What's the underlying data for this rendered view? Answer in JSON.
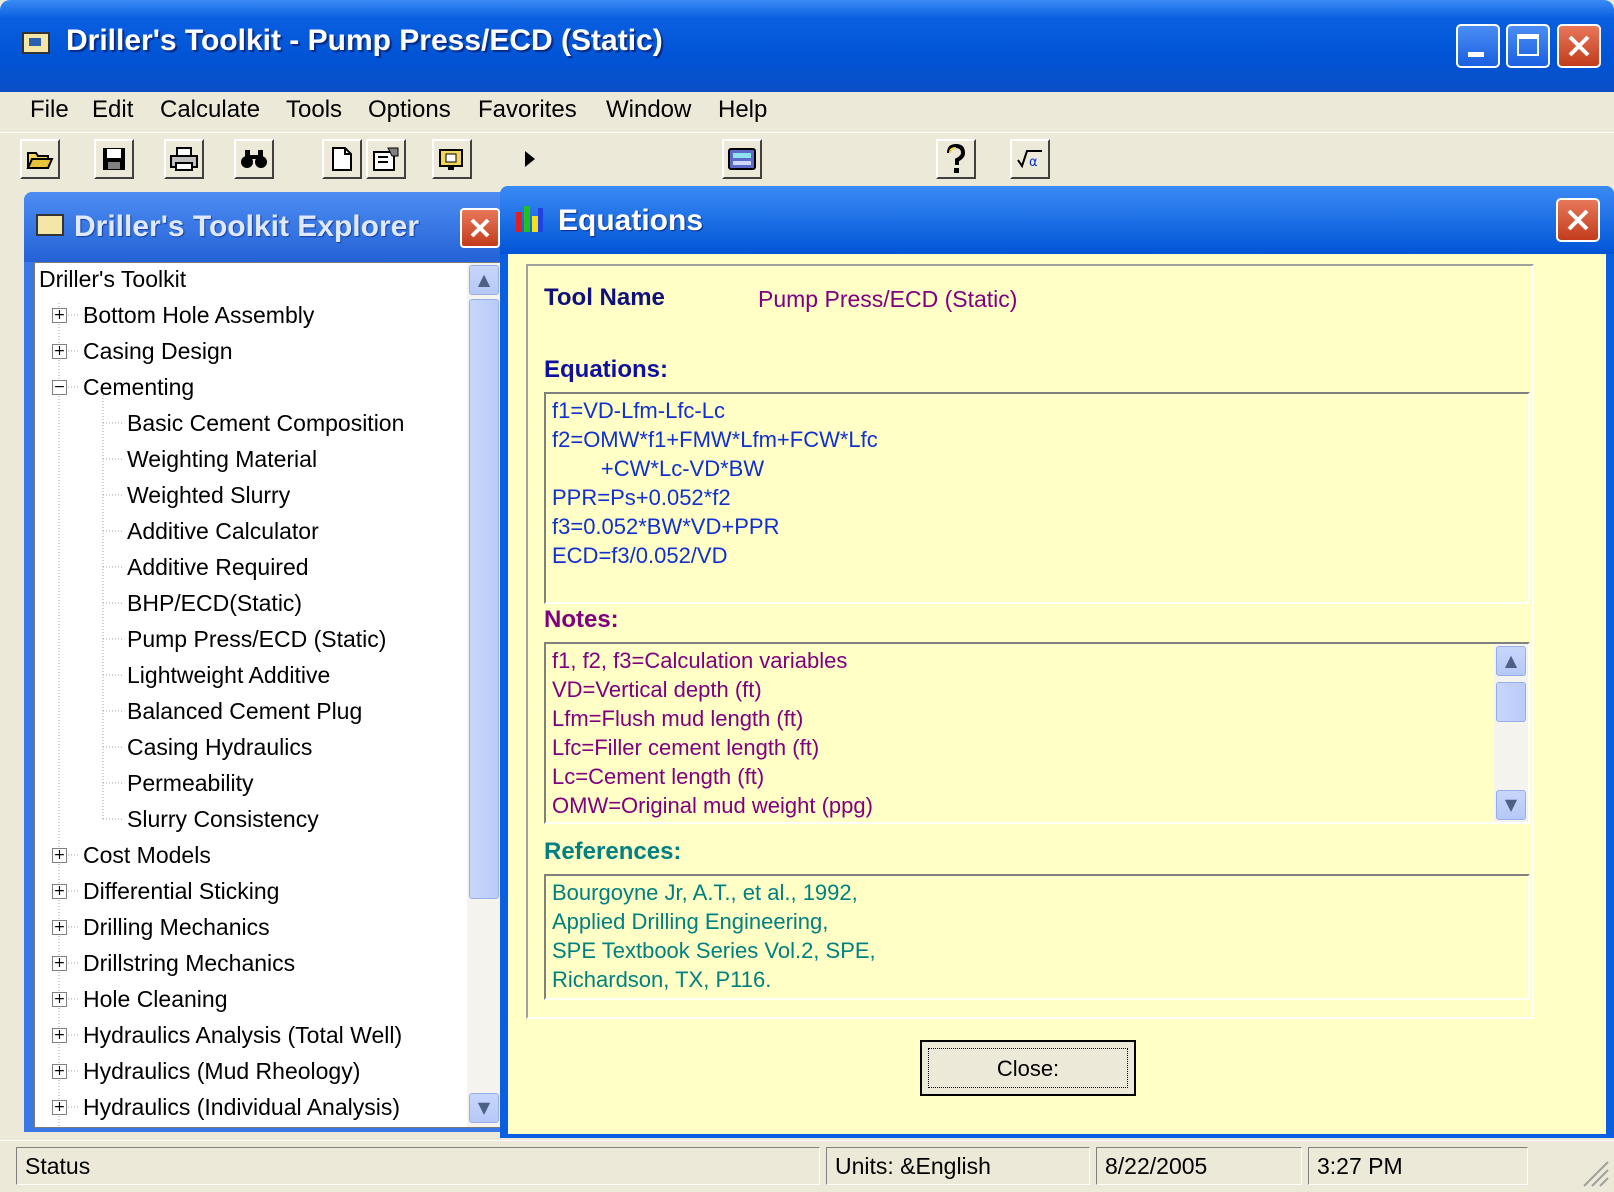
{
  "window": {
    "title": "Driller's Toolkit - Pump Press/ECD (Static)"
  },
  "menu": [
    "File",
    "Edit",
    "Calculate",
    "Tools",
    "Options",
    "Favorites",
    "Window",
    "Help"
  ],
  "toolbar": [
    "open-folder-icon",
    "save-icon",
    "print-icon",
    "find-icon",
    "new-document-icon",
    "properties-icon",
    "report-icon",
    "run-icon",
    "calculator-icon",
    "help-icon",
    "equation-icon"
  ],
  "explorer": {
    "title": "Driller's Toolkit Explorer",
    "root": "Driller's Toolkit",
    "items": [
      {
        "label": "Bottom Hole Assembly",
        "level": 1,
        "expander": "+"
      },
      {
        "label": "Casing Design",
        "level": 1,
        "expander": "+"
      },
      {
        "label": "Cementing",
        "level": 1,
        "expander": "−"
      },
      {
        "label": "Basic Cement Composition",
        "level": 2
      },
      {
        "label": "Weighting Material",
        "level": 2
      },
      {
        "label": "Weighted Slurry",
        "level": 2
      },
      {
        "label": "Additive Calculator",
        "level": 2
      },
      {
        "label": "Additive Required",
        "level": 2
      },
      {
        "label": "BHP/ECD(Static)",
        "level": 2
      },
      {
        "label": "Pump Press/ECD (Static)",
        "level": 2
      },
      {
        "label": "Lightweight Additive",
        "level": 2
      },
      {
        "label": "Balanced Cement Plug",
        "level": 2
      },
      {
        "label": "Casing Hydraulics",
        "level": 2
      },
      {
        "label": "Permeability",
        "level": 2
      },
      {
        "label": "Slurry Consistency",
        "level": 2
      },
      {
        "label": "Cost Models",
        "level": 1,
        "expander": "+"
      },
      {
        "label": "Differential Sticking",
        "level": 1,
        "expander": "+"
      },
      {
        "label": "Drilling Mechanics",
        "level": 1,
        "expander": "+"
      },
      {
        "label": "Drillstring Mechanics",
        "level": 1,
        "expander": "+"
      },
      {
        "label": "Hole Cleaning",
        "level": 1,
        "expander": "+"
      },
      {
        "label": "Hydraulics Analysis (Total Well)",
        "level": 1,
        "expander": "+"
      },
      {
        "label": "Hydraulics (Mud Rheology)",
        "level": 1,
        "expander": "+"
      },
      {
        "label": "Hydraulics (Individual Analysis)",
        "level": 1,
        "expander": "+"
      }
    ]
  },
  "equations": {
    "title": "Equations",
    "tool_name_label": "Tool Name",
    "tool_name": "Pump Press/ECD (Static)",
    "equations_label": "Equations:",
    "equation_lines": [
      "f1=VD-Lfm-Lfc-Lc",
      "f2=OMW*f1+FMW*Lfm+FCW*Lfc",
      "        +CW*Lc-VD*BW",
      "PPR=Ps+0.052*f2",
      "f3=0.052*BW*VD+PPR",
      "ECD=f3/0.052/VD"
    ],
    "notes_label": "Notes:",
    "note_lines": [
      "f1, f2, f3=Calculation variables",
      "VD=Vertical depth (ft)",
      "Lfm=Flush mud length (ft)",
      "Lfc=Filler cement length (ft)",
      "Lc=Cement length (ft)",
      "OMW=Original mud weight (ppg)"
    ],
    "references_label": "References:",
    "reference_lines": [
      "Bourgoyne Jr, A.T., et al., 1992,",
      "Applied Drilling Engineering,",
      "SPE Textbook Series Vol.2, SPE,",
      "Richardson, TX, P116."
    ],
    "close_button": "Close:"
  },
  "status": {
    "text": "Status",
    "units": "Units: &English",
    "date": "8/22/2005",
    "time": "3:27 PM"
  }
}
